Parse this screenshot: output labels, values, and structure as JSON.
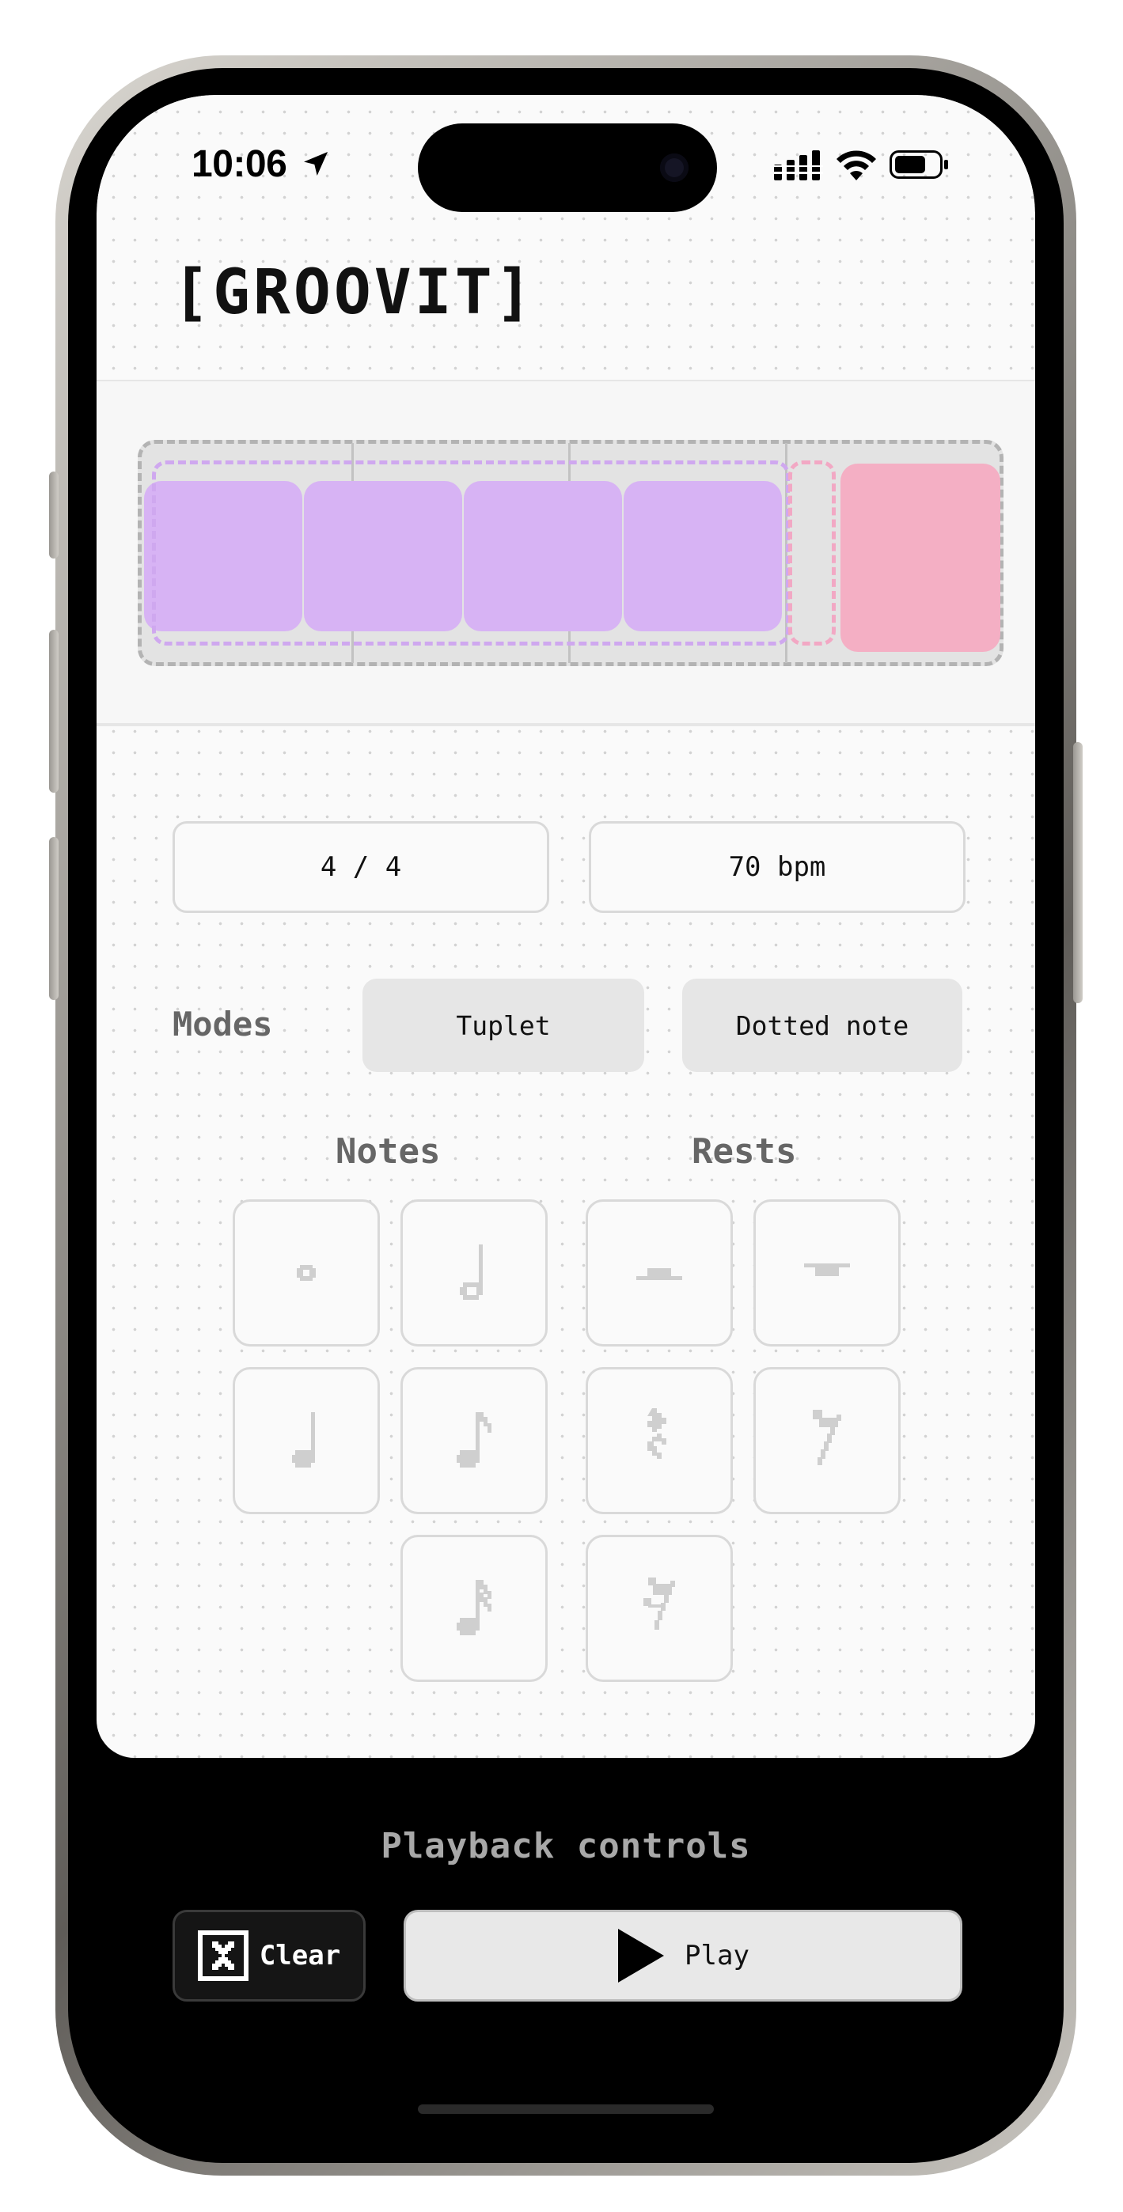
{
  "status_bar": {
    "time": "10:06",
    "icons": [
      "location-arrow-icon",
      "cellular-signal-icon",
      "wifi-icon",
      "battery-icon"
    ]
  },
  "app": {
    "title": "[GROOVIT]"
  },
  "timeline": {
    "beats_per_measure": 4,
    "blocks": [
      {
        "kind": "note",
        "group": "tuplet",
        "color": "#d7b3f4"
      },
      {
        "kind": "note",
        "group": "tuplet",
        "color": "#d7b3f4"
      },
      {
        "kind": "note",
        "group": "tuplet",
        "color": "#d7b3f4"
      },
      {
        "kind": "note",
        "group": "tuplet",
        "color": "#d7b3f4"
      },
      {
        "kind": "rest",
        "color": "#f4afc4"
      }
    ],
    "colors": {
      "tuplet_outline": "#cfa8ef",
      "rest_outline": "#f2a8c4",
      "measure_border": "#b3b3b3"
    }
  },
  "settings": {
    "time_signature": "4 / 4",
    "tempo": "70 bpm"
  },
  "modes": {
    "label": "Modes",
    "tuplet_label": "Tuplet",
    "dotted_label": "Dotted note"
  },
  "palette": {
    "notes_label": "Notes",
    "rests_label": "Rests",
    "notes": [
      "whole-note-icon",
      "half-note-icon",
      "quarter-note-icon",
      "eighth-note-icon",
      "sixteenth-note-icon"
    ],
    "rests": [
      "whole-rest-icon",
      "half-rest-icon",
      "quarter-rest-icon",
      "eighth-rest-icon",
      "sixteenth-rest-icon"
    ]
  },
  "playback": {
    "label": "Playback controls",
    "clear_label": "Clear",
    "play_label": "Play"
  }
}
